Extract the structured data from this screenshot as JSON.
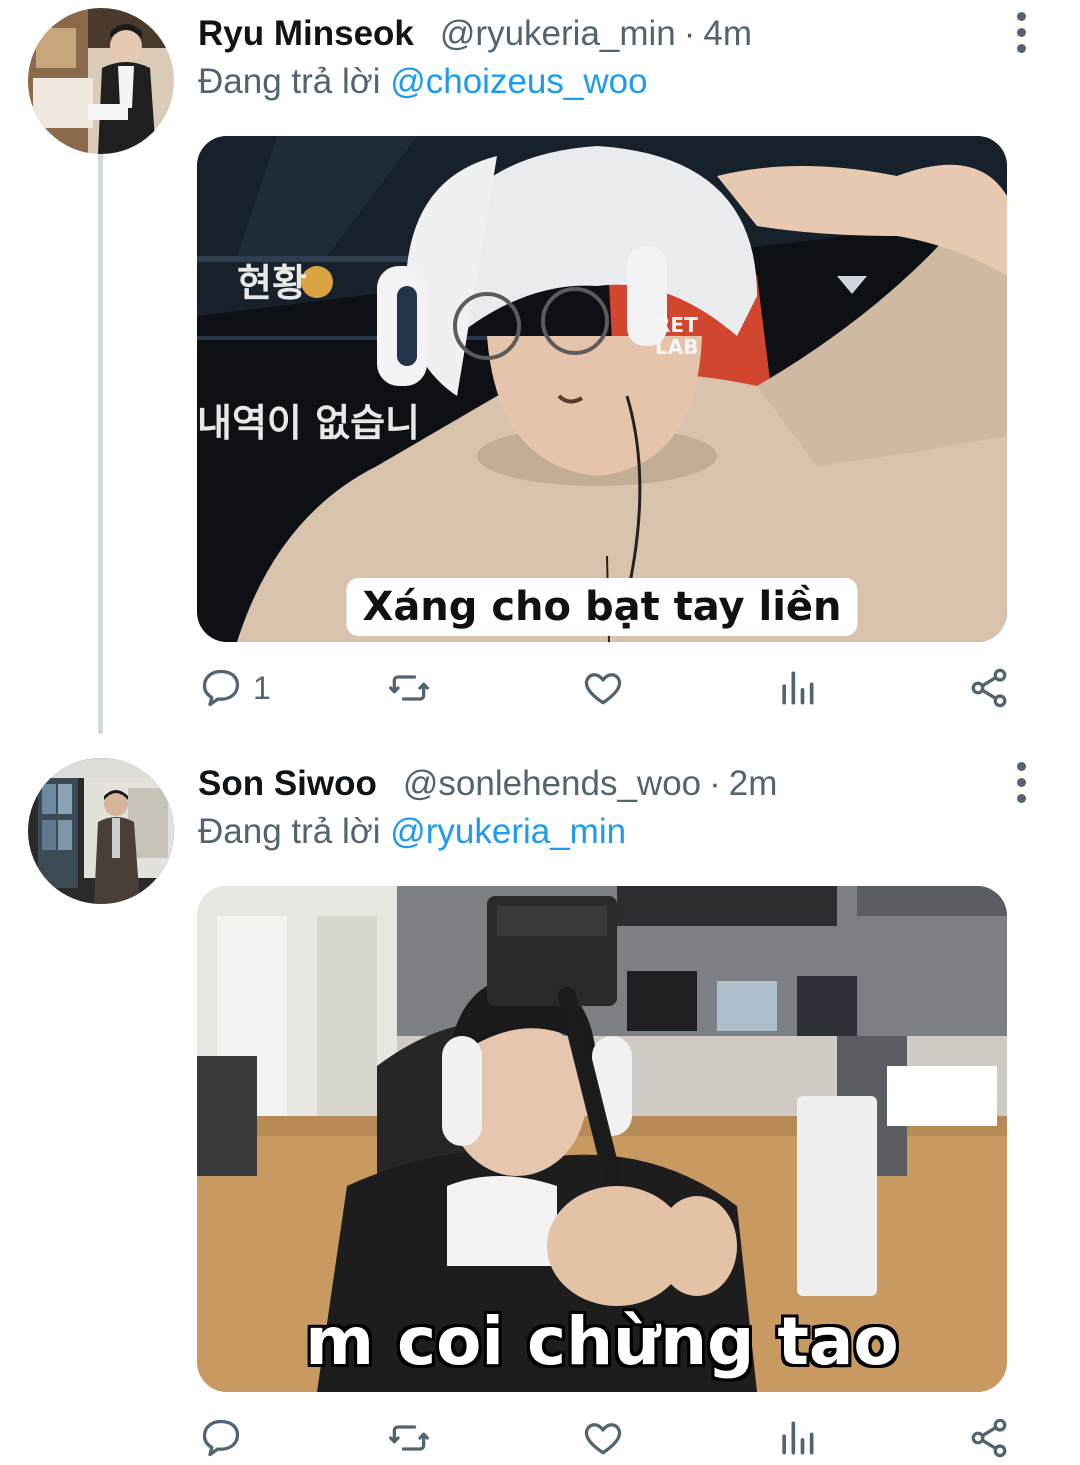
{
  "tweets": [
    {
      "name": "Ryu Minseok",
      "handle": "@ryukeria_min",
      "separator": "·",
      "time": "4m",
      "reply_prefix": "Đang trả lời",
      "reply_to": "@choizeus_woo",
      "media_caption": "Xáng cho bạt tay liền",
      "overlay_text": [
        "현황",
        "내역이 없습니",
        "RET",
        "LAB"
      ],
      "reply_count": "1",
      "retweet_count": "",
      "like_count": ""
    },
    {
      "name": "Son Siwoo",
      "handle": "@sonlehends_woo",
      "separator": "·",
      "time": "2m",
      "reply_prefix": "Đang trả lời",
      "reply_to": "@ryukeria_min",
      "media_caption": "m coi chừng tao",
      "reply_count": "",
      "retweet_count": "",
      "like_count": ""
    }
  ],
  "icons": {
    "reply": "reply-icon",
    "retweet": "retweet-icon",
    "like": "heart-icon",
    "views": "views-icon",
    "share": "share-icon",
    "more": "more-vertical-icon"
  },
  "colors": {
    "link": "#1d9bf0",
    "secondary_text": "#536471",
    "icon": "#536471",
    "thread_line": "#cfd9de"
  }
}
